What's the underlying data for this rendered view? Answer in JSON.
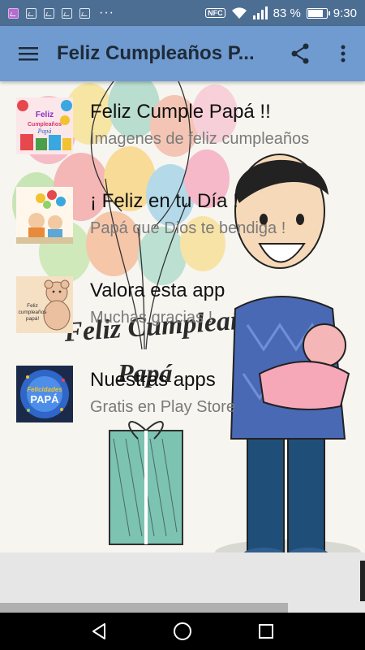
{
  "status_bar": {
    "nfc_label": "NFC",
    "battery_text": "83 %",
    "time": "9:30",
    "overflow_dots": "···"
  },
  "app_bar": {
    "title": "Feliz Cumpleaños P...",
    "menu_icon": "hamburger-menu-icon",
    "share_icon": "share-icon",
    "more_icon": "more-vert-icon"
  },
  "background": {
    "headline": "Feliz Cumpleaños",
    "subline": "Papá"
  },
  "items": [
    {
      "title": "Feliz Cumple Papá !!",
      "subtitle": "Imagenes de feliz cumpleaños",
      "thumb_text": "Feliz Cumpleaños Papá"
    },
    {
      "title": "¡ Feliz en tu Día !",
      "subtitle": "Papá que Dios te bendiga !",
      "thumb_text": ""
    },
    {
      "title": "Valora esta app",
      "subtitle": "Muchas gracias !",
      "thumb_text": "Feliz cumpleaños papá!"
    },
    {
      "title": "Nuestras apps",
      "subtitle": "Gratis en Play Store",
      "thumb_text": "Felicidades PAPÁ"
    }
  ],
  "nav": {
    "back_icon": "back-triangle-icon",
    "home_icon": "home-circle-icon",
    "recents_icon": "recents-square-icon"
  }
}
